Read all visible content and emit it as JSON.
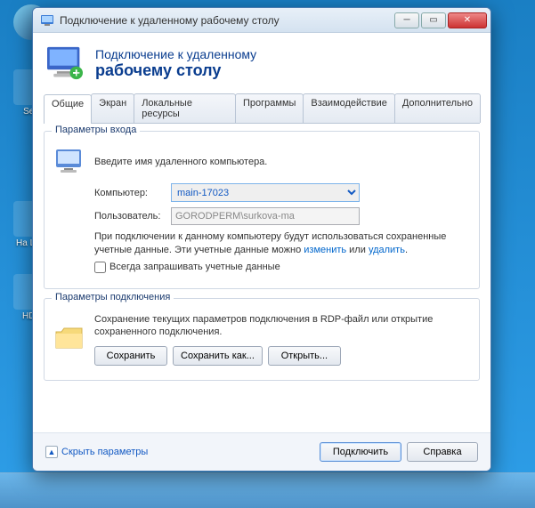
{
  "window": {
    "title": "Подключение к удаленному рабочему столу",
    "header_line1": "Подключение к удаленному",
    "header_line2": "рабочему столу"
  },
  "tabs": [
    "Общие",
    "Экран",
    "Локальные ресурсы",
    "Программы",
    "Взаимодействие",
    "Дополнительно"
  ],
  "login_group": {
    "title": "Параметры входа",
    "instruction": "Введите имя удаленного компьютера.",
    "computer_label": "Компьютер:",
    "computer_value": "main-17023",
    "user_label": "Пользователь:",
    "user_value": "GORODPERM\\surkova-ma",
    "note_before": "При подключении к данному компьютеру будут использоваться сохраненные учетные данные. Эти учетные данные можно ",
    "link_change": "изменить",
    "note_mid": " или ",
    "link_delete": "удалить",
    "note_after": ".",
    "checkbox_label": "Всегда запрашивать учетные данные"
  },
  "conn_group": {
    "title": "Параметры подключения",
    "desc": "Сохранение текущих параметров подключения в RDP-файл или открытие сохраненного подключения.",
    "save": "Сохранить",
    "save_as": "Сохранить как...",
    "open": "Открыть..."
  },
  "footer": {
    "hide": "Скрыть параметры",
    "connect": "Подключить",
    "help": "Справка"
  },
  "desktop": {
    "i1": "",
    "i2": "Sea",
    "i3": "Ha\nLow",
    "i4": "HDL"
  }
}
